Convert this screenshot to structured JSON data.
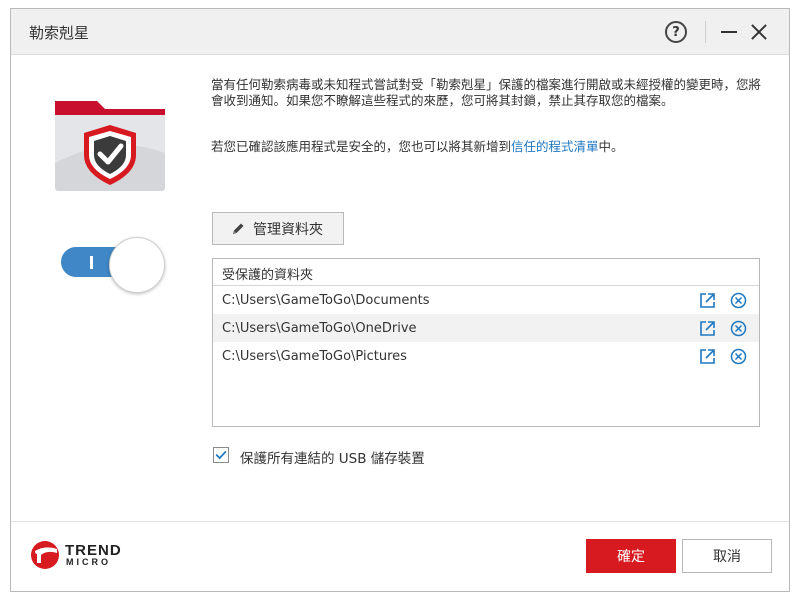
{
  "window": {
    "title": "勒索剋星"
  },
  "titlebar": {
    "help_label": "?"
  },
  "description": {
    "paragraph1": "當有任何勒索病毒或未知程式嘗試對受「勒索剋星」保護的檔案進行開啟或未經授權的變更時，您將會收到通知。如果您不瞭解這些程式的來歷，您可將其封鎖，禁止其存取您的檔案。",
    "paragraph2_before": "若您已確認該應用程式是安全的，您也可以將其新增到",
    "paragraph2_link": "信任的程式清單",
    "paragraph2_after": "中。"
  },
  "toggle": {
    "state": "on"
  },
  "manage": {
    "label": "管理資料夾"
  },
  "folders": {
    "header": "受保護的資料夾",
    "items": [
      {
        "path": "C:\\Users\\GameToGo\\Documents"
      },
      {
        "path": "C:\\Users\\GameToGo\\OneDrive"
      },
      {
        "path": "C:\\Users\\GameToGo\\Pictures"
      }
    ]
  },
  "usb": {
    "checked": true,
    "label": "保護所有連結的 USB 儲存裝置"
  },
  "brand": {
    "line1": "TREND",
    "line2": "MICRO"
  },
  "buttons": {
    "ok": "確定",
    "cancel": "取消"
  },
  "colors": {
    "accent_red": "#d71920",
    "toggle_blue": "#3f87c6",
    "link_blue": "#1f78c2"
  }
}
